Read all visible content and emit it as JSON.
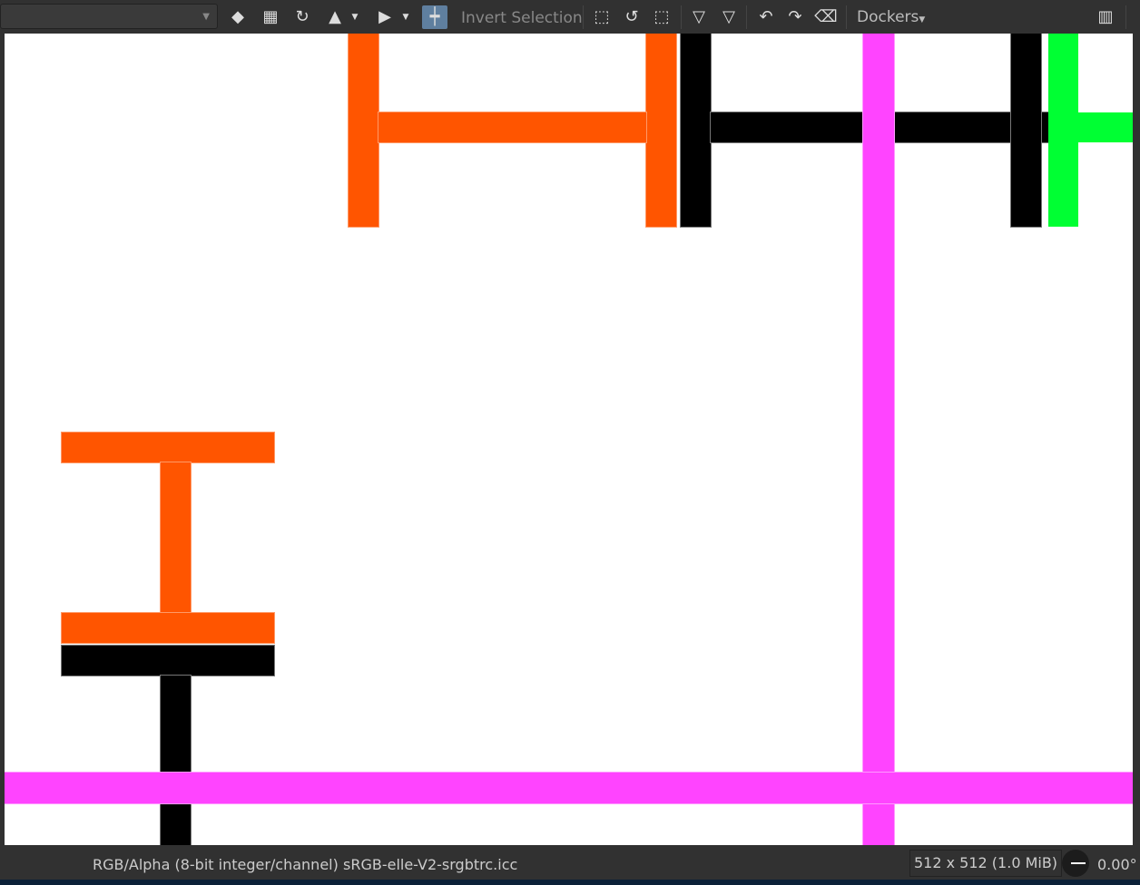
{
  "toolbar": {
    "combo_value": "",
    "invert_selection": "Invert Selection",
    "dockers": "Dockers",
    "icons": [
      "eraser-icon",
      "alpha-lock-icon",
      "reload-preset-icon",
      "mirror-horizontal-icon",
      "mirror-vertical-icon",
      "wrap-around-icon",
      "select-all-icon",
      "deselect-icon",
      "reselect-icon",
      "filter-icon",
      "filter-again-icon",
      "undo-icon",
      "redo-icon",
      "clear-icon",
      "workspace-icon"
    ]
  },
  "status": {
    "color_model": "RGB/Alpha (8-bit integer/channel)",
    "profile": "sRGB-elle-V2-srgbtrc.icc",
    "image_size": "512 x 512 (1.0 MiB)",
    "rotation": "0.00°"
  },
  "colors": {
    "orange": "#ff5500",
    "black": "#000000",
    "green": "#00ff33",
    "magenta": "#ff44ff"
  }
}
